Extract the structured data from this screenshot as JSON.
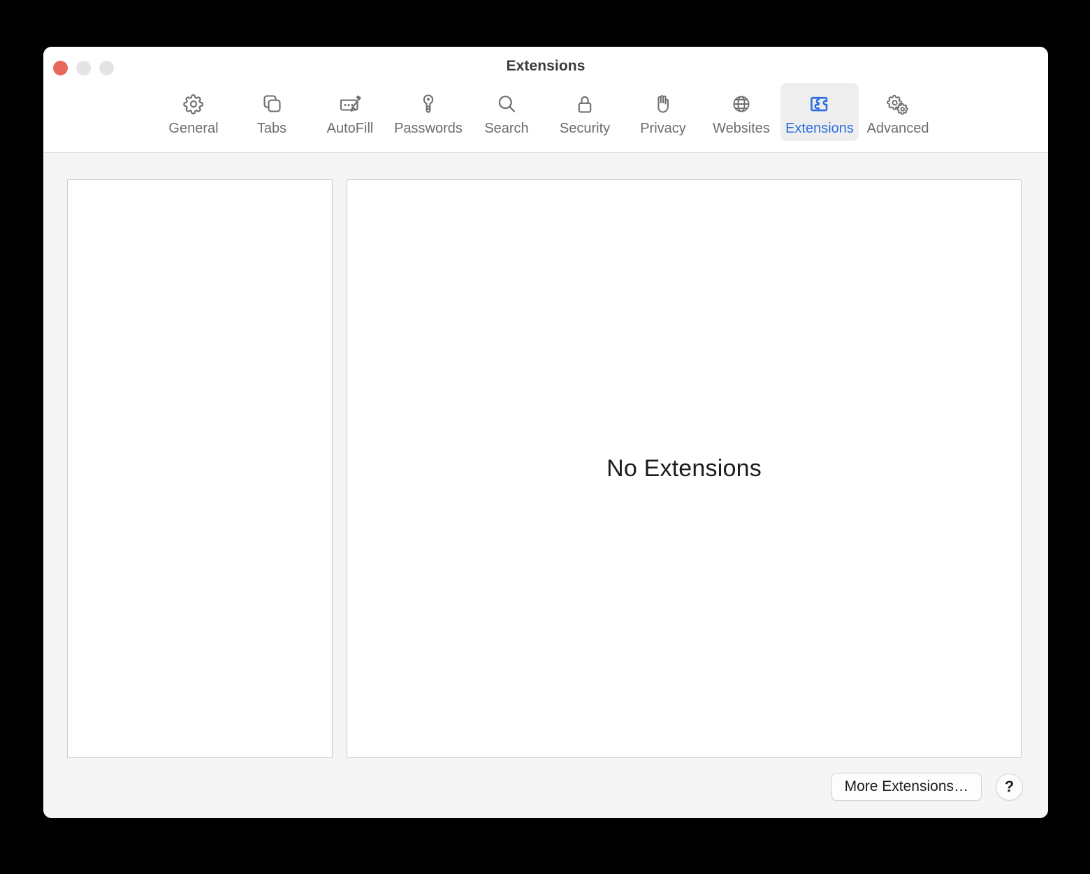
{
  "window": {
    "title": "Extensions",
    "traffic_lights": [
      {
        "name": "close-button",
        "color": "#e8685c"
      },
      {
        "name": "minimize-button",
        "color": "#e4e4e4"
      },
      {
        "name": "zoom-button",
        "color": "#e4e4e4"
      }
    ]
  },
  "toolbar": {
    "selected": "Extensions",
    "tabs": [
      {
        "label": "General",
        "icon": "gear-icon"
      },
      {
        "label": "Tabs",
        "icon": "tabs-icon"
      },
      {
        "label": "AutoFill",
        "icon": "autofill-pencil-icon"
      },
      {
        "label": "Passwords",
        "icon": "key-icon"
      },
      {
        "label": "Search",
        "icon": "magnifier-icon"
      },
      {
        "label": "Security",
        "icon": "lock-icon"
      },
      {
        "label": "Privacy",
        "icon": "hand-icon"
      },
      {
        "label": "Websites",
        "icon": "globe-icon"
      },
      {
        "label": "Extensions",
        "icon": "puzzle-piece-icon"
      },
      {
        "label": "Advanced",
        "icon": "double-gears-icon"
      }
    ]
  },
  "main": {
    "extensions_list": [],
    "empty_message": "No Extensions"
  },
  "footer": {
    "more_extensions_label": "More Extensions…",
    "help_label": "?"
  },
  "colors": {
    "accent": "#2c6fe0",
    "toolbar_bg": "#ffffff",
    "content_bg": "#f5f5f5",
    "panel_bg": "#ffffff",
    "panel_border": "#c8c8c8",
    "icon_gray": "#6e6e6e",
    "close_red": "#e8685c"
  }
}
